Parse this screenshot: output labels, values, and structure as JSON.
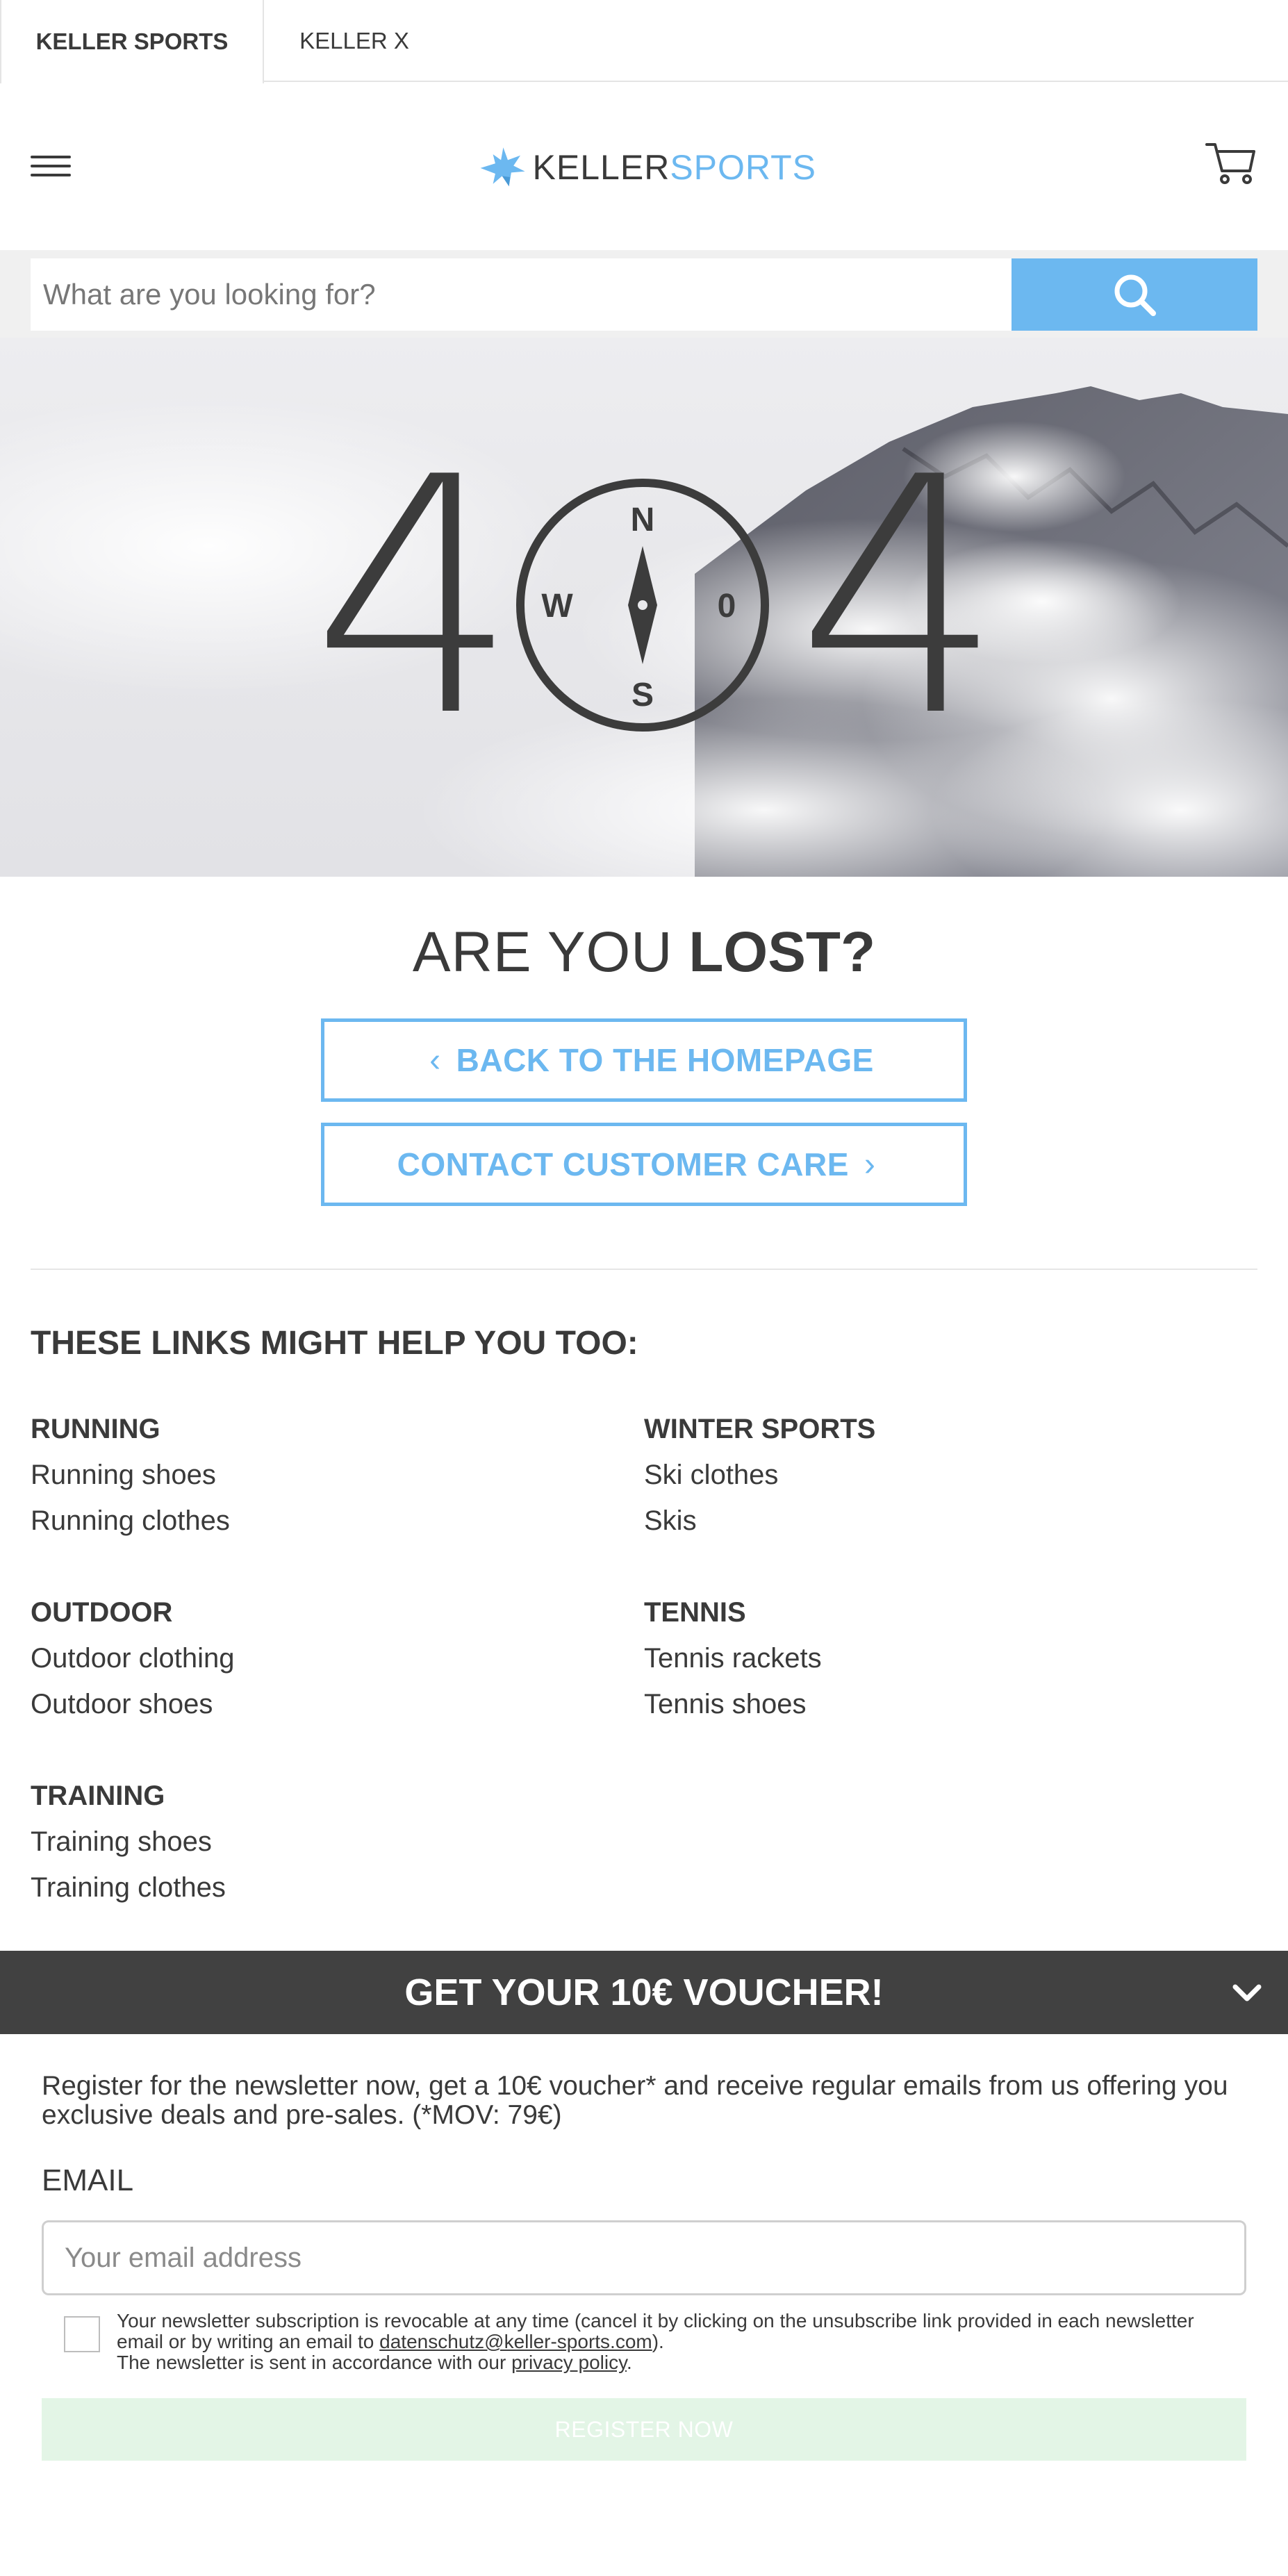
{
  "store_tabs": [
    {
      "label": "KELLER SPORTS",
      "active": true
    },
    {
      "label": "KELLER X",
      "active": false
    }
  ],
  "header": {
    "menu_icon": "hamburger-menu-icon",
    "logo": {
      "part1": "KELLER",
      "part2": "SPORTS",
      "brand_color": "#6cb8f0"
    },
    "cart_icon": "shopping-cart-icon"
  },
  "search": {
    "placeholder": "What are you looking for?",
    "button_icon": "search-icon",
    "button_color": "#6cb8f0"
  },
  "hero": {
    "digit_left": "4",
    "digit_right": "4",
    "compass": {
      "north": "N",
      "south": "S",
      "west": "W",
      "east": "0"
    }
  },
  "lost": {
    "title_light": "ARE YOU",
    "title_bold": "LOST?",
    "back_button": "BACK TO THE HOMEPAGE",
    "care_button": "CONTACT CUSTOMER CARE"
  },
  "helpful_links": {
    "heading": "THESE LINKS MIGHT HELP YOU TOO:",
    "groups": [
      {
        "title": "RUNNING",
        "links": [
          "Running shoes",
          "Running clothes"
        ]
      },
      {
        "title": "WINTER SPORTS",
        "links": [
          "Ski clothes",
          "Skis"
        ]
      },
      {
        "title": "OUTDOOR",
        "links": [
          "Outdoor clothing",
          "Outdoor shoes"
        ]
      },
      {
        "title": "TENNIS",
        "links": [
          "Tennis rackets",
          "Tennis shoes"
        ]
      },
      {
        "title": "TRAINING",
        "links": [
          "Training shoes",
          "Training clothes"
        ]
      }
    ]
  },
  "newsletter": {
    "banner": "GET YOUR 10€ VOUCHER!",
    "toggle_icon": "chevron-down-icon",
    "description": "Register for the newsletter now, get a 10€ voucher* and receive regular emails from us offering you exclusive deals and pre-sales. (*MOV: 79€)",
    "email_label": "EMAIL",
    "email_placeholder": "Your email address",
    "legal_part1": "Your newsletter subscription is revocable at any time (cancel it by clicking on the unsubscribe link provided in each newsletter email or by writing an email to ",
    "legal_email": "datenschutz@keller-sports.com",
    "legal_part2": ").",
    "legal_part3": "The newsletter is sent in accordance with our ",
    "legal_privacy": "privacy policy",
    "legal_part4": ".",
    "register_button": "REGISTER NOW"
  }
}
